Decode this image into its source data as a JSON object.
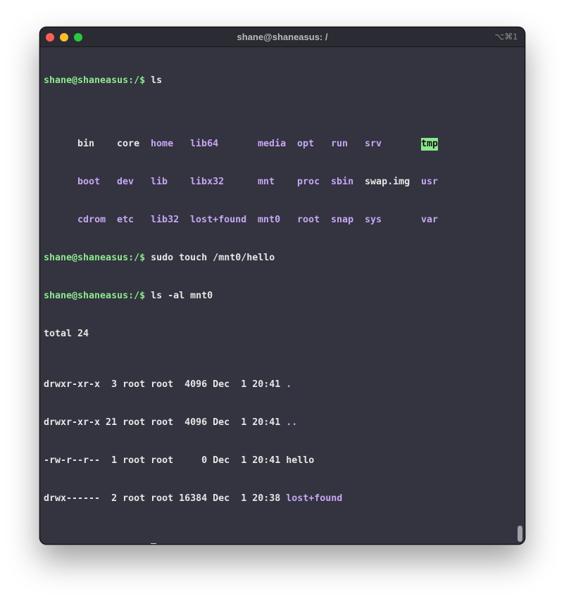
{
  "window": {
    "title": "shane@shaneasus: /",
    "shortcut": "⌥⌘1"
  },
  "colors": {
    "background": "#33343f",
    "prompt": "#8ee88e",
    "directory": "#c7a6f5",
    "sticky_bg": "#8ee88e",
    "text": "#e6e6e6"
  },
  "prompt": "shane@shaneasus:/$",
  "terminal": {
    "cmd1": "ls",
    "ls_rows": [
      [
        "bin",
        "core",
        "home",
        "lib64",
        "media",
        "opt",
        "run",
        "srv",
        "tmp"
      ],
      [
        "boot",
        "dev",
        "lib",
        "libx32",
        "mnt",
        "proc",
        "sbin",
        "swap.img",
        "usr"
      ],
      [
        "cdrom",
        "etc",
        "lib32",
        "lost+found",
        "mnt0",
        "root",
        "snap",
        "sys",
        "var"
      ]
    ],
    "cmd2": "sudo touch /mnt0/hello",
    "cmd3": "ls -al mnt0",
    "total": "total 24",
    "entries": [
      {
        "meta": "drwxr-xr-x  3 root root  4096 Dec  1 20:41 ",
        "name": "."
      },
      {
        "meta": "drwxr-xr-x 21 root root  4096 Dec  1 20:41 ",
        "name": ".."
      },
      {
        "meta": "-rw-r--r--  1 root root     0 Dec  1 20:41 ",
        "name": "hello"
      },
      {
        "meta": "drwx------  2 root root 16384 Dec  1 20:38 ",
        "name": "lost+found"
      }
    ]
  }
}
